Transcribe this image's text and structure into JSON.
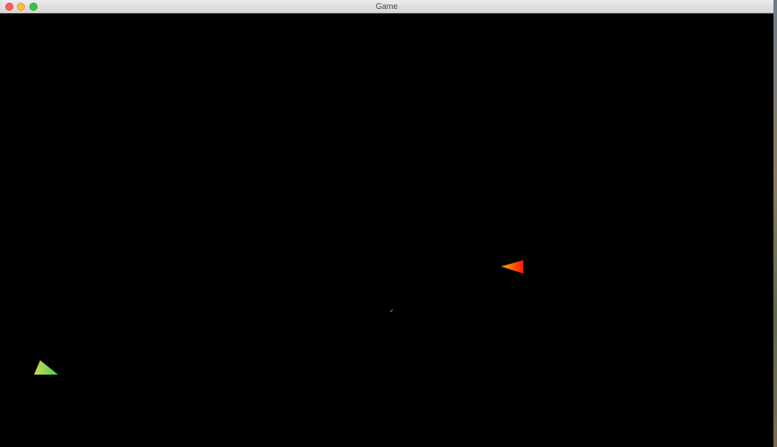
{
  "window": {
    "title": "Game"
  },
  "colors": {
    "canvas_background": "#000000",
    "player_ship": [
      "#d8d060",
      "#3fd84a"
    ],
    "enemy_ship": [
      "#ffb000",
      "#ff1800"
    ],
    "bullet": "#e0e060"
  },
  "icons": {
    "close": "close-icon",
    "minimize": "minimize-icon",
    "zoom": "zoom-icon"
  }
}
